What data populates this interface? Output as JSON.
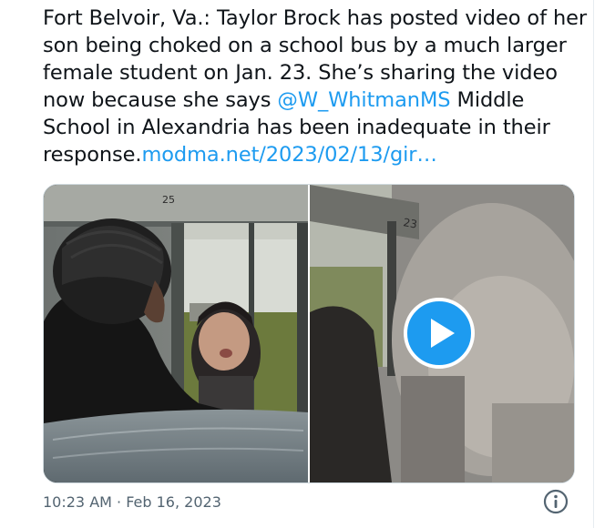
{
  "tweet": {
    "lines": [
      "Fort Belvoir, Va.: Taylor Brock has posted video of her",
      "son being choked on a school bus by a much larger",
      "female student on Jan. 23. She’s sharing the video"
    ],
    "line4_before": "now because she says ",
    "mention": "@W_WhitmanMS",
    "line4_after": " Middle",
    "line5": "School in Alexandria has been inadequate in their",
    "line6_before": "response.",
    "url": "modma.net/2023/02/13/gir…"
  },
  "media": {
    "left_label": "25",
    "right_label": "23",
    "play_icon": "play-icon"
  },
  "meta": {
    "timestamp": "10:23 AM · Feb 16, 2023",
    "info_icon": "info-icon"
  },
  "colors": {
    "link": "#1d9bf0",
    "text": "#0f1419",
    "muted": "#536471",
    "border": "#cfd9de"
  }
}
